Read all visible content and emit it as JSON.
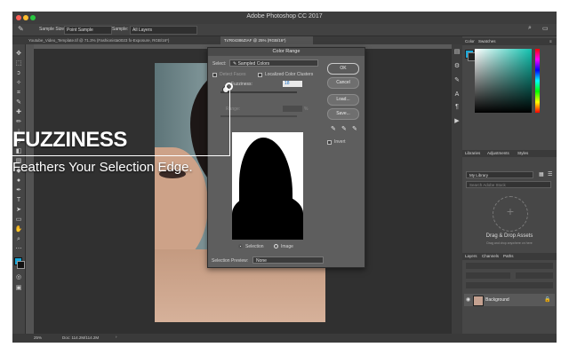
{
  "app": {
    "title": "Adobe Photoshop CC 2017"
  },
  "colors": {
    "traffic_red": "#ff5f57",
    "traffic_yellow": "#ffbd2e",
    "traffic_green": "#28c840",
    "accent": "#1aa7d8"
  },
  "options_bar": {
    "sample_size_label": "Sample Size:",
    "sample_size_value": "Point Sample",
    "sample_label": "Sample:",
    "sample_value": "All Layers"
  },
  "doc_tabs": [
    {
      "label": "Youtube_Video_Template.tif @ 71.3% (Fashionista0023 fx-Exposure, RGB/16*)",
      "active": false
    },
    {
      "label": "Tx'R04386ZIAF @ 25% (RGB/16*)",
      "active": true
    }
  ],
  "status": {
    "zoom": "25%",
    "doc": "Doc: 114.2M/114.2M"
  },
  "panels": {
    "color_tabs": [
      "Color",
      "Swatches"
    ],
    "library_tabs": [
      "Libraries",
      "Adjustments",
      "Styles"
    ],
    "library_select": "My Library",
    "library_search_placeholder": "Search Adobe Stock",
    "drag_title": "Drag & Drop Assets",
    "drag_sub": "Drag and drop anywhere on here",
    "layers_tabs": [
      "Layers",
      "Channels",
      "Paths"
    ],
    "layer_name": "Background"
  },
  "dialog": {
    "title": "Color Range",
    "select_label": "Select:",
    "select_value": "Sampled Colors",
    "detect_faces": "Detect Faces",
    "localized": "Localized Color Clusters",
    "fuzziness_label": "Fuzziness:",
    "fuzziness_value": "18",
    "range_label": "Range:",
    "range_unit": "%",
    "selection_label": "Selection",
    "image_label": "Image",
    "preview_label": "Selection Preview:",
    "preview_value": "None",
    "ok": "OK",
    "cancel": "Cancel",
    "load": "Load...",
    "save": "Save...",
    "invert": "Invert"
  },
  "overlay": {
    "title": "FUZZINESS",
    "subtitle": "Feathers Your Selection Edge."
  }
}
